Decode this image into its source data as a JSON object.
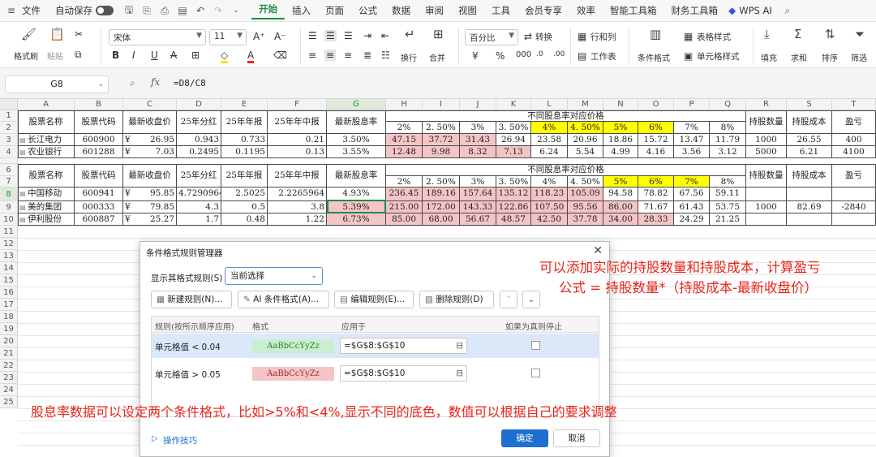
{
  "menubar": {
    "file_label": "文件",
    "autosave_label": "自动保存",
    "tabs": [
      "开始",
      "插入",
      "页面",
      "公式",
      "数据",
      "审阅",
      "视图",
      "工具",
      "会员专享",
      "效率",
      "智能工具箱",
      "财务工具箱"
    ],
    "ai_label": "WPS AI"
  },
  "ribbon": {
    "format_painter": "格式刷",
    "paste": "粘贴",
    "font_name": "宋体",
    "font_size": "11",
    "wrap": "换行",
    "merge": "合并",
    "number_format": "百分比",
    "convert": "转换",
    "rows_cols": "行和列",
    "worksheet": "工作表",
    "conditional_format": "条件格式",
    "table_style": "表格样式",
    "cell_style": "单元格样式",
    "fill": "填充",
    "sum": "求和",
    "sort": "排序",
    "filter": "筛选"
  },
  "formula_bar": {
    "cell_ref": "G8",
    "fx": "fx",
    "formula": "=D8/C8"
  },
  "columns": [
    "A",
    "B",
    "C",
    "D",
    "E",
    "F",
    "G",
    "H",
    "I",
    "J",
    "K",
    "L",
    "M",
    "N",
    "O",
    "P",
    "Q",
    "R",
    "S",
    "T"
  ],
  "rows": [
    "1",
    "2",
    "3",
    "4",
    "5",
    "6",
    "7",
    "8",
    "9",
    "10",
    "11",
    "12",
    "13",
    "14",
    "15",
    "16",
    "17",
    "18",
    "19",
    "20",
    "21",
    "22",
    "23",
    "24",
    "25"
  ],
  "table1": {
    "headers": [
      "股票名称",
      "股票代码",
      "最新收盘价",
      "25年分红",
      "25年年报",
      "25年年中报",
      "最新股息率"
    ],
    "price_header": "不同股息率对应价格",
    "rates": [
      "2%",
      "2. 50%",
      "3%",
      "3. 50%",
      "4%",
      "4. 50%",
      "5%",
      "6%",
      "7%",
      "8%"
    ],
    "right_headers": [
      "持股数量",
      "持股成本",
      "盈亏"
    ],
    "rows": [
      {
        "name": "长江电力",
        "code": "600900",
        "price": "¥ 26.95",
        "div": "0.943",
        "annual": "0.733",
        "mid": "0.21",
        "yield": "3.50%",
        "prices": [
          "47.15",
          "37.72",
          "31.43",
          "26.94",
          "23.58",
          "20.96",
          "18.86",
          "15.72",
          "13.47",
          "11.79"
        ],
        "qty": "1000",
        "cost": "26.55",
        "pnl": "400"
      },
      {
        "name": "农业银行",
        "code": "601288",
        "price": "¥ 7.03",
        "div": "0.2495",
        "annual": "0.1195",
        "mid": "0.13",
        "yield": "3.55%",
        "prices": [
          "12.48",
          "9.98",
          "8.32",
          "7.13",
          "6.24",
          "5.54",
          "4.99",
          "4.16",
          "3.56",
          "3.12"
        ],
        "qty": "5000",
        "cost": "6.21",
        "pnl": "4100"
      }
    ]
  },
  "table2": {
    "headers": [
      "股票名称",
      "股票代码",
      "最新收盘价",
      "25年分红",
      "25年年报",
      "25年年中报",
      "最新股息率"
    ],
    "price_header": "不同股息率对应价格",
    "rates": [
      "2%",
      "2. 50%",
      "3%",
      "3. 50%",
      "4%",
      "4. 50%",
      "5%",
      "6%",
      "7%",
      "8%"
    ],
    "right_headers": [
      "持股数量",
      "持股成本",
      "盈亏"
    ],
    "rows": [
      {
        "name": "中国移动",
        "code": "600941",
        "price": "¥ 95.85",
        "div": "4.7290964",
        "annual": "2.5025",
        "mid": "2.2265964",
        "yield": "4.93%",
        "prices": [
          "236.45",
          "189.16",
          "157.64",
          "135.12",
          "118.23",
          "105.09",
          "94.58",
          "78.82",
          "67.56",
          "59.11"
        ],
        "qty": "",
        "cost": "",
        "pnl": ""
      },
      {
        "name": "美的集团",
        "code": "000333",
        "price": "¥ 79.85",
        "div": "4.3",
        "annual": "0.5",
        "mid": "3.8",
        "yield": "5.39%",
        "prices": [
          "215.00",
          "172.00",
          "143.33",
          "122.86",
          "107.50",
          "95.56",
          "86.00",
          "71.67",
          "61.43",
          "53.75"
        ],
        "qty": "1000",
        "cost": "82.69",
        "pnl": "-2840"
      },
      {
        "name": "伊利股份",
        "code": "600887",
        "price": "¥ 25.27",
        "div": "1.7",
        "annual": "0.48",
        "mid": "1.22",
        "yield": "6.73%",
        "prices": [
          "85.00",
          "68.00",
          "56.67",
          "48.57",
          "42.50",
          "37.78",
          "34.00",
          "28.33",
          "24.29",
          "21.25"
        ],
        "qty": "",
        "cost": "",
        "pnl": ""
      }
    ]
  },
  "dialog": {
    "title": "条件格式规则管理器",
    "show_label": "显示其格式规则(S)",
    "show_value": "当前选择",
    "new_rule": "新建规则(N)...",
    "ai_rule": "AI 条件格式(A)...",
    "edit_rule": "编辑规则(E)...",
    "delete_rule": "删除规则(D)",
    "col_rule": "规则(按所示顺序应用)",
    "col_format": "格式",
    "col_applies": "应用于",
    "col_stop": "如果为真则停止",
    "rules": [
      {
        "rule": "单元格值 < 0.04",
        "sample": "AaBbCcYyZz",
        "applies": "=$G$8:$G$10"
      },
      {
        "rule": "单元格值 > 0.05",
        "sample": "AaBbCcYyZz",
        "applies": "=$G$8:$G$10"
      }
    ],
    "tips": "操作技巧",
    "ok": "确定",
    "cancel": "取消"
  },
  "annotations": {
    "note1_line1": "可以添加实际的持股数量和持股成本，计算盈亏",
    "note1_line2": "公式 = 持股数量*（持股成本-最新收盘价）",
    "note2": "股息率数据可以设定两个条件格式，比如>5%和<4%,显示不同的底色，数值可以根据自己的要求调整"
  },
  "colors": {
    "accent_green": "#1d8f46",
    "pink_fill": "#f4c4c7",
    "green_fill": "#c9efce",
    "yellow_fill": "#ffff00",
    "annotation_red": "#e8231a",
    "ok_blue": "#1f6fd1"
  }
}
